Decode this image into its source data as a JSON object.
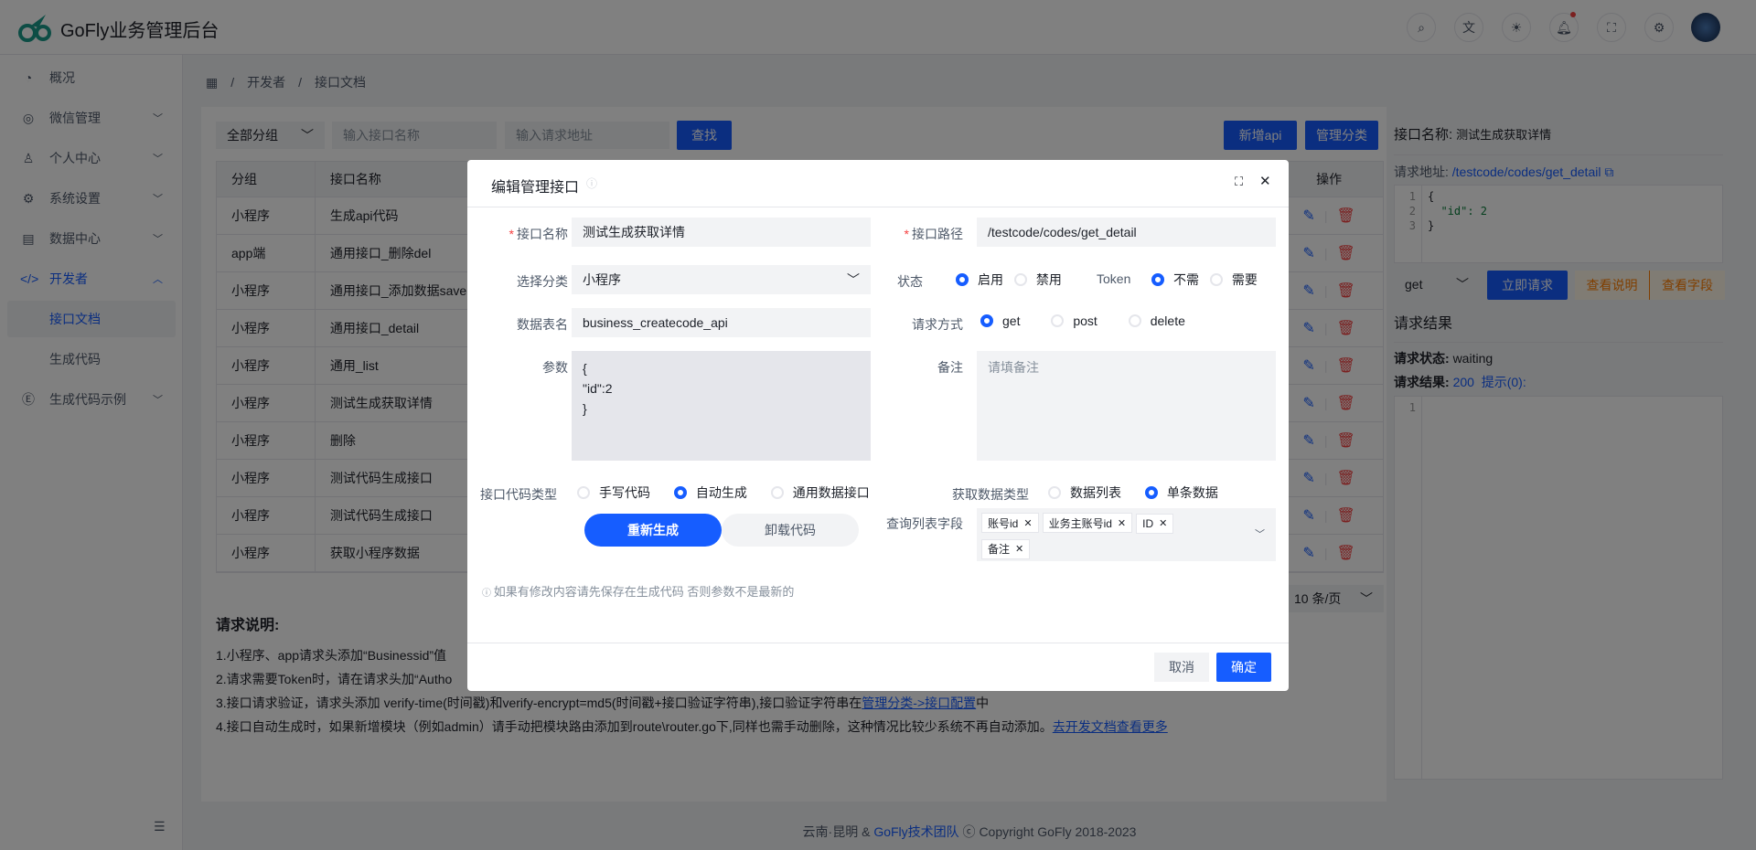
{
  "header": {
    "title": "GoFly业务管理后台",
    "icons": [
      "search-icon",
      "translate-icon",
      "theme-icon",
      "bell-icon",
      "fullscreen-icon",
      "settings-icon"
    ]
  },
  "sidebar": {
    "items": [
      {
        "label": "概况",
        "icon": "dashboard-icon"
      },
      {
        "label": "微信管理",
        "icon": "wechat-icon"
      },
      {
        "label": "个人中心",
        "icon": "user-icon"
      },
      {
        "label": "系统设置",
        "icon": "gear-icon"
      },
      {
        "label": "数据中心",
        "icon": "database-icon"
      },
      {
        "label": "开发者",
        "icon": "code-icon"
      },
      {
        "label": "接口文档"
      },
      {
        "label": "生成代码"
      },
      {
        "label": "生成代码示例",
        "icon": "example-icon"
      }
    ]
  },
  "breadcrumb": [
    "开发者",
    "接口文档"
  ],
  "filters": {
    "group": "全部分组",
    "name_placeholder": "输入接口名称",
    "url_placeholder": "输入请求地址",
    "search": "查找",
    "add": "新增api",
    "manage": "管理分类"
  },
  "table": {
    "headers": [
      "分组",
      "接口名称",
      "操作"
    ],
    "rows": [
      [
        "小程序",
        "生成api代码"
      ],
      [
        "app端",
        "通用接口_删除del"
      ],
      [
        "小程序",
        "通用接口_添加数据save"
      ],
      [
        "小程序",
        "通用接口_detail"
      ],
      [
        "小程序",
        "通用_list"
      ],
      [
        "小程序",
        "测试生成获取详情"
      ],
      [
        "小程序",
        "删除"
      ],
      [
        "小程序",
        "测试代码生成接口"
      ],
      [
        "小程序",
        "测试代码生成接口"
      ],
      [
        "小程序",
        "获取小程序数据"
      ]
    ]
  },
  "pagination": {
    "page_size": "10 条/页"
  },
  "notes": {
    "title": "请求说明:",
    "lines": [
      "1.小程序、app请求头添加“Businessid”值",
      "2.请求需要Token时，请在请求头加“Autho",
      "3.接口请求验证，请求头添加 verify-time(时间戳)和verify-encrypt=md5(时间戳+接口验证字符串),接口验证字符串在",
      "4.接口自动生成时，如果新增模块（例如admin）请手动把模块路由添加到route\\router.go下,同样也需手动删除，这种情况比较少系统不再自动添加。"
    ],
    "line3_link": "管理分类->接口配置",
    "line3_tail": "中",
    "line4_link": "去开发文档查看更多"
  },
  "right": {
    "name_label": "接口名称:",
    "name": "测试生成获取详情",
    "url_label": "请求地址:",
    "url": "/testcode/codes/get_detail",
    "code": [
      "{",
      "  \"id\": 2",
      "}"
    ],
    "method": "get",
    "send": "立即请求",
    "view_desc": "查看说明",
    "view_fields": "查看字段",
    "result_title": "请求结果",
    "status_label": "请求状态:",
    "status": "waiting",
    "result_label": "请求结果:",
    "result_code": "200",
    "hint": "提示(0):"
  },
  "footer": {
    "prefix": "云南·昆明 & ",
    "team": "GoFly技术团队",
    "suffix": " ⓒ Copyright GoFly 2018-2023"
  },
  "modal": {
    "title": "编辑管理接口",
    "name_label": "接口名称",
    "name": "测试生成获取详情",
    "path_label": "接口路径",
    "path": "/testcode/codes/get_detail",
    "category_label": "选择分类",
    "category": "小程序",
    "status_label": "状态",
    "status_options": [
      "启用",
      "禁用"
    ],
    "status_selected": "启用",
    "token_label": "Token",
    "token_options": [
      "不需",
      "需要"
    ],
    "token_selected": "不需",
    "table_label": "数据表名",
    "table": "business_createcode_api",
    "method_label": "请求方式",
    "method_options": [
      "get",
      "post",
      "delete"
    ],
    "method_selected": "get",
    "params_label": "参数",
    "params": [
      "{",
      "\"id\":2",
      "}"
    ],
    "remark_label": "备注",
    "remark_placeholder": "请填备注",
    "codetype_label": "接口代码类型",
    "codetype_options": [
      "手写代码",
      "自动生成",
      "通用数据接口"
    ],
    "codetype_selected": "自动生成",
    "datatype_label": "获取数据类型",
    "datatype_options": [
      "数据列表",
      "单条数据"
    ],
    "datatype_selected": "单条数据",
    "regen": "重新生成",
    "uninstall": "卸载代码",
    "fields_label": "查询列表字段",
    "fields": [
      "账号id",
      "业务主账号id",
      "ID",
      "备注"
    ],
    "hint": "如果有修改内容请先保存在生成代码 否则参数不是最新的",
    "cancel": "取消",
    "ok": "确定"
  },
  "colors": {
    "primary": "#165dff",
    "danger": "#f53f3f",
    "warning": "#ff7d00"
  }
}
